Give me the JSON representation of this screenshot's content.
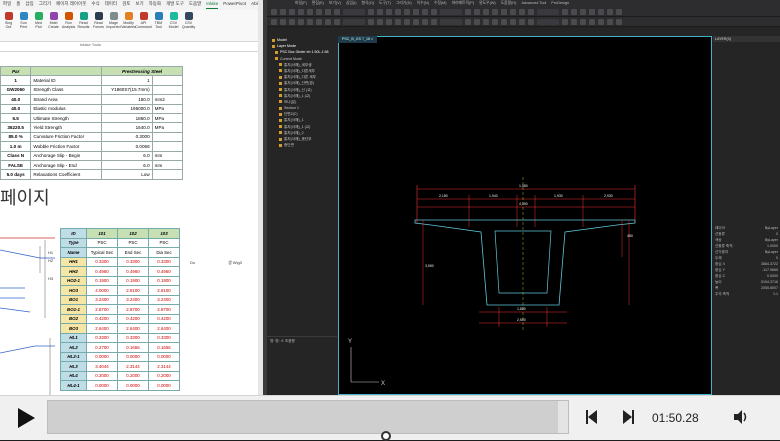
{
  "excel": {
    "tabs": [
      "파일",
      "홈",
      "삽입",
      "그리기",
      "페이지 레이아웃",
      "수식",
      "데이터",
      "검토",
      "보기",
      "자동화",
      "개발 도구",
      "도움말",
      "Inlake",
      "PowerPivot",
      "Ablebits",
      "Ablebits Data",
      "Ablebits Tools",
      "AbleSite",
      "Jeef Design",
      "Sheet Sync",
      "AlisDPV"
    ],
    "active_tab": "Inlake",
    "ribbon_buttons": [
      "Sing Out",
      "Sun Print",
      "Med Plot",
      "Mdel Create",
      "Run Analysis",
      "Read Results",
      "Read Forces",
      "Mage Imported",
      "Modify Variables",
      "API Command",
      "TBM Tool",
      "CSV Model",
      "CSV Quantity"
    ],
    "ribbon_group_label": "Inlake Tools",
    "prestress_table": {
      "headers": [
        "Par",
        "",
        "Prestressing Steel"
      ],
      "rows": [
        {
          "key": "1",
          "label": "Material ID",
          "value": "1",
          "unit": ""
        },
        {
          "key": "GW2060",
          "label": "Strength Class",
          "value": "Y1860S7(15.7mm)",
          "unit": ""
        },
        {
          "key": "40.0",
          "label": "Strand Area",
          "value": "150.0",
          "unit": "mm2"
        },
        {
          "key": "40.0",
          "label": "Elastic modulus",
          "value": "195000.0",
          "unit": "MPa"
        },
        {
          "key": "5.5",
          "label": "Ultimate Strength",
          "value": "1860.0",
          "unit": "MPa"
        },
        {
          "key": "35220.5",
          "label": "Yield Strength",
          "value": "1640.0",
          "unit": "MPa"
        },
        {
          "key": "85.0 %",
          "label": "Curvature Friction Factor",
          "value": "0.3000",
          "unit": ""
        },
        {
          "key": "1.0 m",
          "label": "Wobble Friction Factor",
          "value": "0.0066",
          "unit": ""
        },
        {
          "key": "Class N",
          "label": "Anchorage Slip - Begin",
          "value": "6.0",
          "unit": "mm"
        },
        {
          "key": "FALSE",
          "label": "Anchorage Slip - End",
          "value": "6.0",
          "unit": "mm"
        },
        {
          "key": "5.0 days",
          "label": "Relaxations Coefficient",
          "value": "Low",
          "unit": ""
        }
      ]
    },
    "big_text": "페이지",
    "section_table": {
      "header": [
        "ID",
        "101",
        "102",
        "103"
      ],
      "type_row": [
        "Type",
        "PSC",
        "PSC",
        "PSC"
      ],
      "name_row": [
        "Name",
        "Typical Sec",
        "End Sec",
        "Dia Sec"
      ],
      "rows_a": [
        [
          "HH1",
          "0.3300",
          "0.3300",
          "0.3300"
        ],
        [
          "HH2",
          "0.4960",
          "0.4960",
          "0.4960"
        ],
        [
          "HO2-1",
          "0.1900",
          "0.1900",
          "0.1900"
        ],
        [
          "HO3",
          "4.0000",
          "2.8100",
          "2.8100"
        ],
        [
          "BO1",
          "3.2400",
          "3.2400",
          "3.2400"
        ],
        [
          "BO1-1",
          "2.8700",
          "2.8700",
          "2.8700"
        ],
        [
          "BO2",
          "0.4200",
          "0.4200",
          "0.4200"
        ],
        [
          "BO3",
          "2.6400",
          "2.6400",
          "2.6400"
        ]
      ],
      "rows_b": [
        [
          "HL1",
          "0.3300",
          "0.3300",
          "0.3300"
        ],
        [
          "HL2",
          "0.2700",
          "0.1656",
          "0.1656"
        ],
        [
          "HL2-1",
          "0.0000",
          "0.0000",
          "0.0000"
        ],
        [
          "HL3",
          "3.4044",
          "2.3144",
          "2.3144"
        ],
        [
          "HL4",
          "0.2000",
          "0.2000",
          "0.2000"
        ],
        [
          "HL4-1",
          "0.0000",
          "0.0000",
          "0.0000"
        ]
      ]
    },
    "side_labels": [
      "H1",
      "H2",
      "H3"
    ],
    "note_left": "Do",
    "note_right": "생 Wig3"
  },
  "cad": {
    "menu": [
      "파일(F)",
      "편집(E)",
      "보기(V)",
      "삽입(I)",
      "형식(O)",
      "도구(T)",
      "그리기(D)",
      "치수(N)",
      "수정(M)",
      "파라메트릭(P)",
      "윈도우(W)",
      "도움말(H)",
      "Advanced Tool",
      "ProDesign"
    ],
    "viewport_tab": "PSC_B_GS 7_18 ×",
    "tree_items": [
      "Model",
      "Layer Mode",
      "PSC Box Girder eb 1.50L.1.58",
      "Current Mode",
      "통치(서해)_세부생",
      "통치(서해)_다른세부",
      "통치(서해)_다른 세부",
      "통치(서해)_단면(경)",
      "통치(서해)_신 (교)",
      "통치(서해)_1 (교)",
      "보나(분)",
      "Section 1",
      "단면2(C)",
      "통치(서해)_1",
      "통치(서해)_1 (교)",
      "통치(서해)_2",
      "통치(서해)_종단부",
      "종단면"
    ],
    "tree_bottom": "명: 명: 스 초음향",
    "props_title": "LAYER(0)",
    "props_rows": [
      [
        "레이어",
        "ByLayer"
      ],
      [
        "선종류",
        "0"
      ],
      [
        "색상",
        "ByLayer"
      ],
      [
        "선종류 축척",
        "1.0000"
      ],
      [
        "선가중치",
        "ByLayer"
      ],
      [
        "두께",
        "0"
      ],
      [
        "중심 X",
        "3884.3722"
      ],
      [
        "중심 Y",
        "-117.9665"
      ],
      [
        "중심 Z",
        "0.0000"
      ],
      [
        "높이",
        "5194.3716"
      ],
      [
        "폭",
        "2055.8007"
      ],
      [
        "주석 축척",
        "1:1"
      ]
    ],
    "dims": [
      "1,080",
      "2,180",
      "1,940",
      "1,930",
      "2,930",
      "4,390",
      "450",
      "3,550",
      "1,800",
      "2,500"
    ]
  },
  "player": {
    "time": "01:50.28",
    "progress": 0.98
  }
}
